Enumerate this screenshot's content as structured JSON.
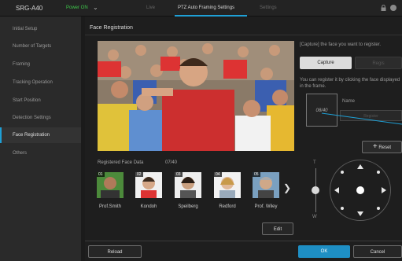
{
  "header": {
    "model": "SRG-A40",
    "power": "Power ON",
    "tabs": [
      {
        "label": "Live"
      },
      {
        "label": "PTZ Auto Framing Settings"
      },
      {
        "label": "Settings"
      }
    ]
  },
  "sidebar": {
    "items": [
      {
        "label": "Initial Setup"
      },
      {
        "label": "Number of Targets"
      },
      {
        "label": "Framing"
      },
      {
        "label": "Tracking Operation"
      },
      {
        "label": "Start Position"
      },
      {
        "label": "Detection Settings"
      },
      {
        "label": "Face Registration"
      },
      {
        "label": "Others"
      }
    ]
  },
  "main": {
    "title": "Face Registration",
    "capture_instruction": "[Capture] the face you want to register.",
    "capture_button": "Capture",
    "register_button_top": "Regis",
    "register_instruction": "You can register it by clicking the face displayed in the frame.",
    "count_box": "08/40",
    "name_label": "Name",
    "name_placeholder": "Register",
    "reset_button": "Reset",
    "registered_label": "Registered Face Data",
    "registered_count": "07/40",
    "faces": [
      {
        "num": "01",
        "name": "Prof.Smith"
      },
      {
        "num": "02",
        "name": "Kondoh"
      },
      {
        "num": "03",
        "name": "Speilberg"
      },
      {
        "num": "04",
        "name": "Redford"
      },
      {
        "num": "05",
        "name": "Prof. Wiley"
      }
    ],
    "edit_button": "Edit",
    "zoom_tele": "T",
    "zoom_wide": "W"
  },
  "footer": {
    "reload": "Reload",
    "ok": "OK",
    "cancel": "Cancel"
  },
  "colors": {
    "accent": "#1ea0d6",
    "power": "#3ec64a",
    "ok": "#1e8fc5"
  }
}
